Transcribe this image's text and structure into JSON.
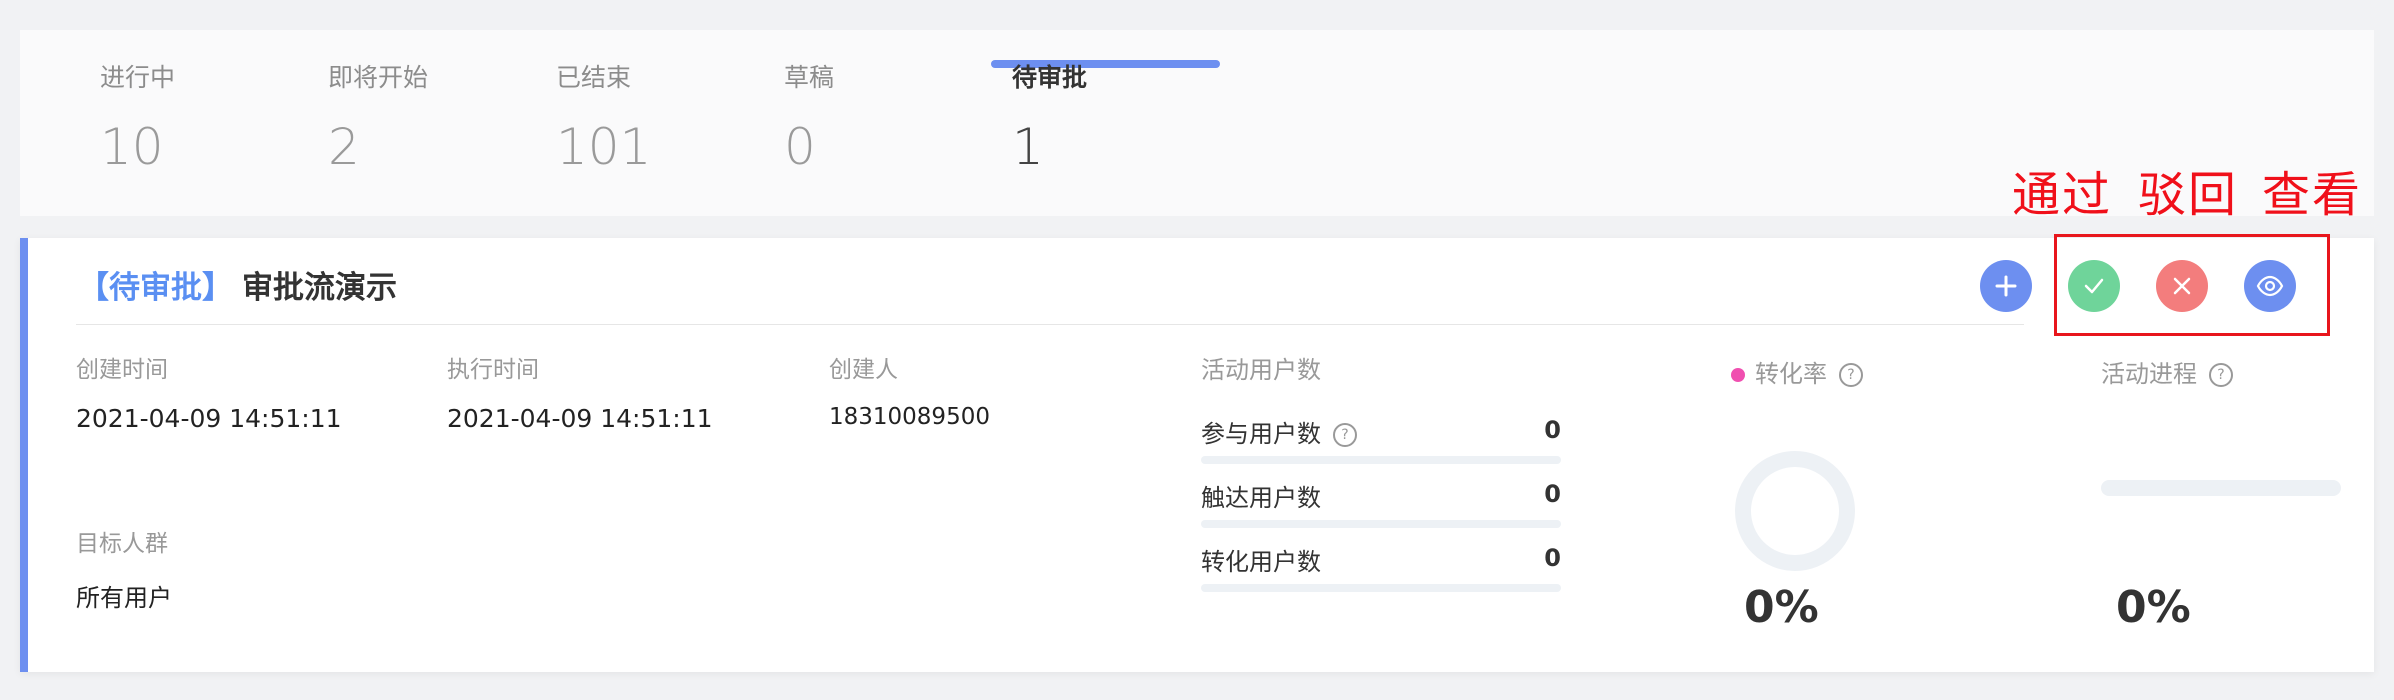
{
  "tabs": [
    {
      "label": "进行中",
      "count": "10"
    },
    {
      "label": "即将开始",
      "count": "2"
    },
    {
      "label": "已结束",
      "count": "101"
    },
    {
      "label": "草稿",
      "count": "0"
    },
    {
      "label": "待审批",
      "count": "1"
    }
  ],
  "annotations": {
    "approve": "通过",
    "reject": "驳回",
    "view": "查看"
  },
  "card": {
    "status_tag": "【待审批】",
    "title": "审批流演示",
    "created_time_label": "创建时间",
    "created_time": "2021-04-09 14:51:11",
    "exec_time_label": "执行时间",
    "exec_time": "2021-04-09 14:51:11",
    "creator_label": "创建人",
    "creator": "18310089500",
    "audience_label": "目标人群",
    "audience": "所有用户",
    "active_users_label": "活动用户数",
    "stats": [
      {
        "label": "参与用户数",
        "value": "0",
        "help": true,
        "fraction": 0
      },
      {
        "label": "触达用户数",
        "value": "0",
        "help": false,
        "fraction": 0
      },
      {
        "label": "转化用户数",
        "value": "0",
        "help": false,
        "fraction": 0
      }
    ],
    "conversion": {
      "label": "转化率",
      "value": "0%",
      "fraction": 0
    },
    "progress": {
      "label": "活动进程",
      "value": "0%",
      "fraction": 0
    }
  },
  "icons": {
    "add": "plus-icon",
    "approve": "check-icon",
    "reject": "close-icon",
    "view": "eye-icon",
    "help": "question-icon"
  },
  "colors": {
    "accent": "#6d8ff0",
    "approve": "#6fd49a",
    "reject": "#f37d7d",
    "annotation": "#f0101a",
    "dot": "#f04fb0"
  }
}
